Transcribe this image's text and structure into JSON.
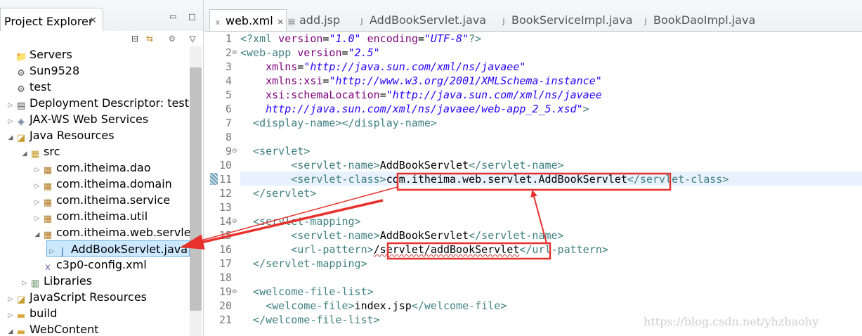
{
  "explorer": {
    "title": "Project Explorer",
    "close_glyph": "✕",
    "tree": [
      {
        "label": "Servers",
        "icon": "server-folder-icon",
        "depth": 0,
        "twisty": ""
      },
      {
        "label": "Sun9528",
        "icon": "project-icon",
        "depth": 0,
        "twisty": ""
      },
      {
        "label": "test",
        "icon": "web-project-icon",
        "depth": 0,
        "twisty": ""
      },
      {
        "label": "Deployment Descriptor: test",
        "icon": "descriptor-icon",
        "depth": 0,
        "twisty": "▷"
      },
      {
        "label": "JAX-WS Web Services",
        "icon": "webservice-icon",
        "depth": 0,
        "twisty": "▷"
      },
      {
        "label": "Java Resources",
        "icon": "java-resources-icon",
        "depth": 0,
        "twisty": "◢"
      },
      {
        "label": "src",
        "icon": "source-folder-icon",
        "depth": 1,
        "twisty": "◢"
      },
      {
        "label": "com.itheima.dao",
        "icon": "package-icon",
        "depth": 2,
        "twisty": "▷"
      },
      {
        "label": "com.itheima.domain",
        "icon": "package-icon",
        "depth": 2,
        "twisty": "▷"
      },
      {
        "label": "com.itheima.service",
        "icon": "package-icon",
        "depth": 2,
        "twisty": "▷"
      },
      {
        "label": "com.itheima.util",
        "icon": "package-icon",
        "depth": 2,
        "twisty": "▷"
      },
      {
        "label": "com.itheima.web.servlet",
        "icon": "package-icon",
        "depth": 2,
        "twisty": "◢"
      },
      {
        "label": "AddBookServlet.java",
        "icon": "java-file-icon",
        "depth": 3,
        "twisty": "▷",
        "selected": true
      },
      {
        "label": "c3p0-config.xml",
        "icon": "xml-file-icon",
        "depth": 2,
        "twisty": ""
      },
      {
        "label": "Libraries",
        "icon": "libraries-icon",
        "depth": 1,
        "twisty": "▷"
      },
      {
        "label": "JavaScript Resources",
        "icon": "javascript-resources-icon",
        "depth": 0,
        "twisty": "▷"
      },
      {
        "label": "build",
        "icon": "folder-icon",
        "depth": 0,
        "twisty": "▷"
      },
      {
        "label": "WebContent",
        "icon": "folder-icon",
        "depth": 0,
        "twisty": "◢"
      }
    ]
  },
  "editor": {
    "tabs": [
      {
        "label": "web.xml",
        "icon": "xml-file-icon",
        "active": true,
        "close": "✕"
      },
      {
        "label": "add.jsp",
        "icon": "jsp-file-icon",
        "active": false
      },
      {
        "label": "AddBookServlet.java",
        "icon": "java-file-icon",
        "active": false
      },
      {
        "label": "BookServiceImpl.java",
        "icon": "java-file-icon",
        "active": false
      },
      {
        "label": "BookDaoImpl.java",
        "icon": "java-file-icon",
        "active": false
      }
    ],
    "lines": [
      {
        "n": "1",
        "fold": "",
        "segs": [
          [
            "pi",
            "<?"
          ],
          [
            "tag",
            "xml"
          ],
          [
            "attr",
            " version"
          ],
          [
            "txt",
            "="
          ],
          [
            "val",
            "\"1.0\""
          ],
          [
            "attr",
            " encoding"
          ],
          [
            "txt",
            "="
          ],
          [
            "val",
            "\"UTF-8\""
          ],
          [
            "pi",
            "?>"
          ]
        ]
      },
      {
        "n": "2",
        "fold": "⊖",
        "segs": [
          [
            "tag",
            "<web-app"
          ],
          [
            "attr",
            " version"
          ],
          [
            "txt",
            "="
          ],
          [
            "val",
            "\"2.5\""
          ]
        ]
      },
      {
        "n": "3",
        "fold": "",
        "segs": [
          [
            "attr",
            "    xmlns"
          ],
          [
            "txt",
            "="
          ],
          [
            "val",
            "\"http://java.sun.com/xml/ns/javaee\""
          ]
        ]
      },
      {
        "n": "4",
        "fold": "",
        "segs": [
          [
            "attr",
            "    xmlns:xsi"
          ],
          [
            "txt",
            "="
          ],
          [
            "val",
            "\"http://www.w3.org/2001/XMLSchema-instance\""
          ]
        ]
      },
      {
        "n": "5",
        "fold": "",
        "segs": [
          [
            "attr",
            "    xsi:schemaLocation"
          ],
          [
            "txt",
            "="
          ],
          [
            "val",
            "\"http://java.sun.com/xml/ns/javaee"
          ]
        ]
      },
      {
        "n": "6",
        "fold": "",
        "segs": [
          [
            "val",
            "    http://java.sun.com/xml/ns/javaee/web-app_2_5.xsd\""
          ],
          [
            "tag",
            ">"
          ]
        ]
      },
      {
        "n": "7",
        "fold": "",
        "segs": [
          [
            "tag",
            "  <display-name></display-name>"
          ]
        ]
      },
      {
        "n": "8",
        "fold": "",
        "segs": [
          [
            "txt",
            ""
          ]
        ]
      },
      {
        "n": "9",
        "fold": "⊖",
        "segs": [
          [
            "tag",
            "  <servlet>"
          ]
        ]
      },
      {
        "n": "10",
        "fold": "",
        "segs": [
          [
            "tag",
            "        <servlet-name>"
          ],
          [
            "txt",
            "AddBookServlet"
          ],
          [
            "tag",
            "</servlet-name>"
          ]
        ]
      },
      {
        "n": "11",
        "fold": "",
        "segs": [
          [
            "tag",
            "        <servlet-class>"
          ],
          [
            "txt",
            "com.itheima.web.servlet.AddBookServlet"
          ],
          [
            "tag",
            "</servlet-class>"
          ]
        ]
      },
      {
        "n": "12",
        "fold": "",
        "segs": [
          [
            "tag",
            "  </servlet>"
          ]
        ]
      },
      {
        "n": "13",
        "fold": "",
        "segs": [
          [
            "txt",
            ""
          ]
        ]
      },
      {
        "n": "14",
        "fold": "⊖",
        "segs": [
          [
            "tag",
            "  <servlet-mapping>"
          ]
        ]
      },
      {
        "n": "15",
        "fold": "",
        "segs": [
          [
            "tag",
            "        <servlet-name>"
          ],
          [
            "txt",
            "AddBookServlet"
          ],
          [
            "tag",
            "</servlet-name>"
          ]
        ]
      },
      {
        "n": "16",
        "fold": "",
        "segs": [
          [
            "tag",
            "        <url-pattern>"
          ],
          [
            "txt",
            "/servlet/addBookServlet"
          ],
          [
            "tag",
            "</url-pattern>"
          ]
        ]
      },
      {
        "n": "17",
        "fold": "",
        "segs": [
          [
            "tag",
            "  </servlet-mapping>"
          ]
        ]
      },
      {
        "n": "18",
        "fold": "",
        "segs": [
          [
            "txt",
            ""
          ]
        ]
      },
      {
        "n": "19",
        "fold": "⊖",
        "segs": [
          [
            "tag",
            "  <welcome-file-list>"
          ]
        ]
      },
      {
        "n": "20",
        "fold": "",
        "segs": [
          [
            "tag",
            "    <welcome-file>"
          ],
          [
            "txt",
            "index.jsp"
          ],
          [
            "tag",
            "</welcome-file>"
          ]
        ]
      },
      {
        "n": "21",
        "fold": "",
        "segs": [
          [
            "tag",
            "  </welcome-file-list>"
          ]
        ]
      }
    ],
    "watermark": "https://blog.csdn.net/yhzhaohy"
  },
  "annotation_color": "#e8302c"
}
